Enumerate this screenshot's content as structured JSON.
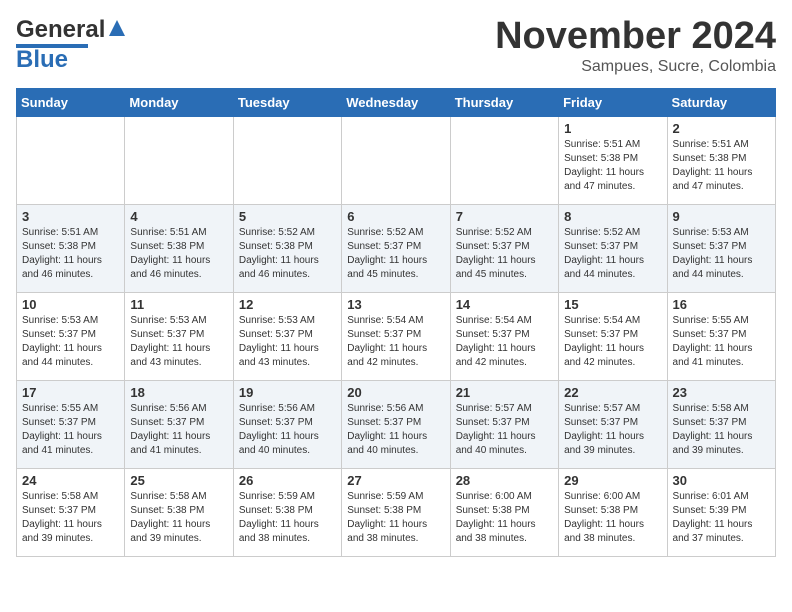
{
  "header": {
    "logo_line1": "General",
    "logo_line2": "Blue",
    "month": "November 2024",
    "location": "Sampues, Sucre, Colombia"
  },
  "weekdays": [
    "Sunday",
    "Monday",
    "Tuesday",
    "Wednesday",
    "Thursday",
    "Friday",
    "Saturday"
  ],
  "weeks": [
    [
      {
        "day": "",
        "info": ""
      },
      {
        "day": "",
        "info": ""
      },
      {
        "day": "",
        "info": ""
      },
      {
        "day": "",
        "info": ""
      },
      {
        "day": "",
        "info": ""
      },
      {
        "day": "1",
        "info": "Sunrise: 5:51 AM\nSunset: 5:38 PM\nDaylight: 11 hours\nand 47 minutes."
      },
      {
        "day": "2",
        "info": "Sunrise: 5:51 AM\nSunset: 5:38 PM\nDaylight: 11 hours\nand 47 minutes."
      }
    ],
    [
      {
        "day": "3",
        "info": "Sunrise: 5:51 AM\nSunset: 5:38 PM\nDaylight: 11 hours\nand 46 minutes."
      },
      {
        "day": "4",
        "info": "Sunrise: 5:51 AM\nSunset: 5:38 PM\nDaylight: 11 hours\nand 46 minutes."
      },
      {
        "day": "5",
        "info": "Sunrise: 5:52 AM\nSunset: 5:38 PM\nDaylight: 11 hours\nand 46 minutes."
      },
      {
        "day": "6",
        "info": "Sunrise: 5:52 AM\nSunset: 5:37 PM\nDaylight: 11 hours\nand 45 minutes."
      },
      {
        "day": "7",
        "info": "Sunrise: 5:52 AM\nSunset: 5:37 PM\nDaylight: 11 hours\nand 45 minutes."
      },
      {
        "day": "8",
        "info": "Sunrise: 5:52 AM\nSunset: 5:37 PM\nDaylight: 11 hours\nand 44 minutes."
      },
      {
        "day": "9",
        "info": "Sunrise: 5:53 AM\nSunset: 5:37 PM\nDaylight: 11 hours\nand 44 minutes."
      }
    ],
    [
      {
        "day": "10",
        "info": "Sunrise: 5:53 AM\nSunset: 5:37 PM\nDaylight: 11 hours\nand 44 minutes."
      },
      {
        "day": "11",
        "info": "Sunrise: 5:53 AM\nSunset: 5:37 PM\nDaylight: 11 hours\nand 43 minutes."
      },
      {
        "day": "12",
        "info": "Sunrise: 5:53 AM\nSunset: 5:37 PM\nDaylight: 11 hours\nand 43 minutes."
      },
      {
        "day": "13",
        "info": "Sunrise: 5:54 AM\nSunset: 5:37 PM\nDaylight: 11 hours\nand 42 minutes."
      },
      {
        "day": "14",
        "info": "Sunrise: 5:54 AM\nSunset: 5:37 PM\nDaylight: 11 hours\nand 42 minutes."
      },
      {
        "day": "15",
        "info": "Sunrise: 5:54 AM\nSunset: 5:37 PM\nDaylight: 11 hours\nand 42 minutes."
      },
      {
        "day": "16",
        "info": "Sunrise: 5:55 AM\nSunset: 5:37 PM\nDaylight: 11 hours\nand 41 minutes."
      }
    ],
    [
      {
        "day": "17",
        "info": "Sunrise: 5:55 AM\nSunset: 5:37 PM\nDaylight: 11 hours\nand 41 minutes."
      },
      {
        "day": "18",
        "info": "Sunrise: 5:56 AM\nSunset: 5:37 PM\nDaylight: 11 hours\nand 41 minutes."
      },
      {
        "day": "19",
        "info": "Sunrise: 5:56 AM\nSunset: 5:37 PM\nDaylight: 11 hours\nand 40 minutes."
      },
      {
        "day": "20",
        "info": "Sunrise: 5:56 AM\nSunset: 5:37 PM\nDaylight: 11 hours\nand 40 minutes."
      },
      {
        "day": "21",
        "info": "Sunrise: 5:57 AM\nSunset: 5:37 PM\nDaylight: 11 hours\nand 40 minutes."
      },
      {
        "day": "22",
        "info": "Sunrise: 5:57 AM\nSunset: 5:37 PM\nDaylight: 11 hours\nand 39 minutes."
      },
      {
        "day": "23",
        "info": "Sunrise: 5:58 AM\nSunset: 5:37 PM\nDaylight: 11 hours\nand 39 minutes."
      }
    ],
    [
      {
        "day": "24",
        "info": "Sunrise: 5:58 AM\nSunset: 5:37 PM\nDaylight: 11 hours\nand 39 minutes."
      },
      {
        "day": "25",
        "info": "Sunrise: 5:58 AM\nSunset: 5:38 PM\nDaylight: 11 hours\nand 39 minutes."
      },
      {
        "day": "26",
        "info": "Sunrise: 5:59 AM\nSunset: 5:38 PM\nDaylight: 11 hours\nand 38 minutes."
      },
      {
        "day": "27",
        "info": "Sunrise: 5:59 AM\nSunset: 5:38 PM\nDaylight: 11 hours\nand 38 minutes."
      },
      {
        "day": "28",
        "info": "Sunrise: 6:00 AM\nSunset: 5:38 PM\nDaylight: 11 hours\nand 38 minutes."
      },
      {
        "day": "29",
        "info": "Sunrise: 6:00 AM\nSunset: 5:38 PM\nDaylight: 11 hours\nand 38 minutes."
      },
      {
        "day": "30",
        "info": "Sunrise: 6:01 AM\nSunset: 5:39 PM\nDaylight: 11 hours\nand 37 minutes."
      }
    ]
  ]
}
